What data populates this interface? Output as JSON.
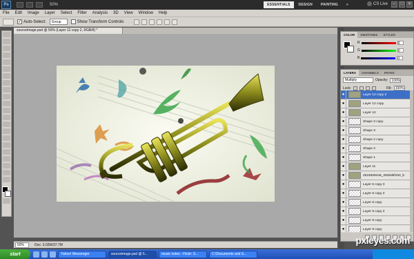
{
  "appbar": {
    "logo": "Ps",
    "zoom": "50%",
    "workspaces": [
      "ESSENTIALS",
      "DESIGN",
      "PAINTING",
      "»"
    ],
    "cs_live": "CS Live",
    "window_controls": [
      "–",
      "□",
      "✕"
    ]
  },
  "menu": [
    "File",
    "Edit",
    "Image",
    "Layer",
    "Select",
    "Filter",
    "Analysis",
    "3D",
    "View",
    "Window",
    "Help"
  ],
  "options": {
    "auto_select_label": "Auto-Select:",
    "auto_select_value": "Group",
    "show_transform_label": "Show Transform Controls"
  },
  "document": {
    "tab_title": "sourceimage.psd @ 50% (Layer 12 copy 2, RGB/8) *",
    "status_zoom": "50%",
    "status_doc": "Doc: 3.02M/37.7M"
  },
  "color_panel": {
    "tabs": [
      "COLOR",
      "SWATCHES",
      "STYLES"
    ],
    "sliders": [
      {
        "label": "R",
        "color": "#d22"
      },
      {
        "label": "G",
        "color": "#2b2"
      },
      {
        "label": "B",
        "color": "#24d"
      }
    ],
    "values": [
      "0",
      "0",
      "0"
    ]
  },
  "layers_panel": {
    "tabs": [
      "LAYERS",
      "CHANNELS",
      "PATHS"
    ],
    "blend_mode": "Multiply",
    "opacity_label": "Opacity:",
    "opacity": "100%",
    "lock_label": "Lock:",
    "fill_label": "Fill:",
    "fill": "100%",
    "layers": [
      {
        "name": "Layer 12 copy 2",
        "selected": true,
        "img": true
      },
      {
        "name": "Layer 12 copy",
        "selected": false,
        "img": true
      },
      {
        "name": "Layer 12",
        "selected": false,
        "img": true
      },
      {
        "name": "Shape 3 copy",
        "selected": false,
        "img": false
      },
      {
        "name": "Shape 3",
        "selected": false,
        "img": false
      },
      {
        "name": "Shape 2 copy",
        "selected": false,
        "img": false
      },
      {
        "name": "Shape 2",
        "selected": false,
        "img": false
      },
      {
        "name": "Shape 1",
        "selected": false,
        "img": false
      },
      {
        "name": "Layer 11",
        "selected": false,
        "img": true
      },
      {
        "name": "4524509446_2926d5f1b0_b",
        "selected": false,
        "img": true
      },
      {
        "name": "Layer 6 copy 3",
        "selected": false,
        "img": false
      },
      {
        "name": "Layer 6 copy 2",
        "selected": false,
        "img": false
      },
      {
        "name": "Layer 6 copy",
        "selected": false,
        "img": false
      },
      {
        "name": "Layer 9 copy 2",
        "selected": false,
        "img": false
      },
      {
        "name": "Layer 9 copy",
        "selected": false,
        "img": false
      },
      {
        "name": "Layer 9 copy",
        "selected": false,
        "img": false
      }
    ]
  },
  "taskbar": {
    "start": "start",
    "tasks": [
      "Yahoo! Messenger",
      "sourceimage.psd @ 5...",
      "music notes - Flickr: S...",
      "C:\\Documents and S..."
    ]
  },
  "watermark": "pxleyes.com"
}
